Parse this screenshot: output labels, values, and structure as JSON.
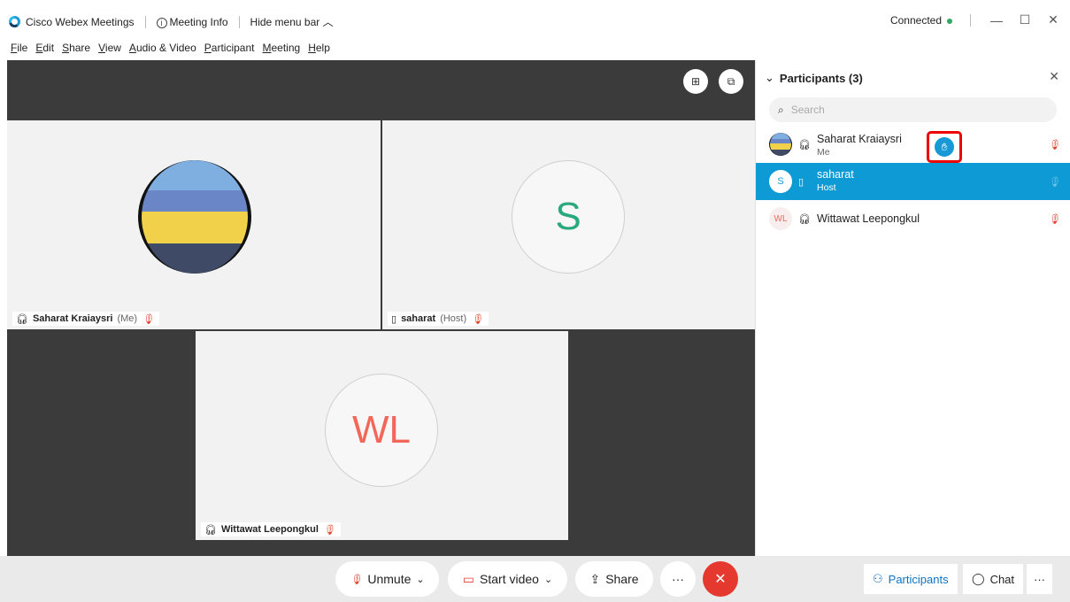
{
  "window": {
    "app_title": "Cisco Webex Meetings",
    "meeting_info": "Meeting Info",
    "hide_menu_bar": "Hide menu bar",
    "status": "Connected",
    "status_color": "#2ea85b"
  },
  "menu": {
    "items": [
      "File",
      "Edit",
      "Share",
      "View",
      "Audio & Video",
      "Participant",
      "Meeting",
      "Help"
    ]
  },
  "stage": {
    "tiles": [
      {
        "name": "Saharat Kraiaysri",
        "tag": "(Me)",
        "avatar_type": "photo"
      },
      {
        "name": "saharat",
        "tag": "(Host)",
        "initials": "S",
        "initials_color": "#2aa87e"
      },
      {
        "name": "Wittawat Leepongkul",
        "tag": "",
        "initials": "WL",
        "initials_color": "#f2675a"
      }
    ]
  },
  "participants_panel": {
    "title": "Participants (3)",
    "search_placeholder": "Search",
    "people": [
      {
        "name": "Saharat Kraiaysri",
        "role": "Me",
        "raised_hand": true
      },
      {
        "name": "saharat",
        "role": "Host",
        "avatar_initial": "S",
        "selected": true
      },
      {
        "name": "Wittawat Leepongkul",
        "role": "",
        "avatar_initial": "WL"
      }
    ]
  },
  "controls": {
    "unmute": "Unmute",
    "start_video": "Start video",
    "share": "Share",
    "more": "···",
    "participants": "Participants",
    "chat": "Chat",
    "end_color": "#e5392f",
    "accent_color": "#0e9ad4"
  }
}
